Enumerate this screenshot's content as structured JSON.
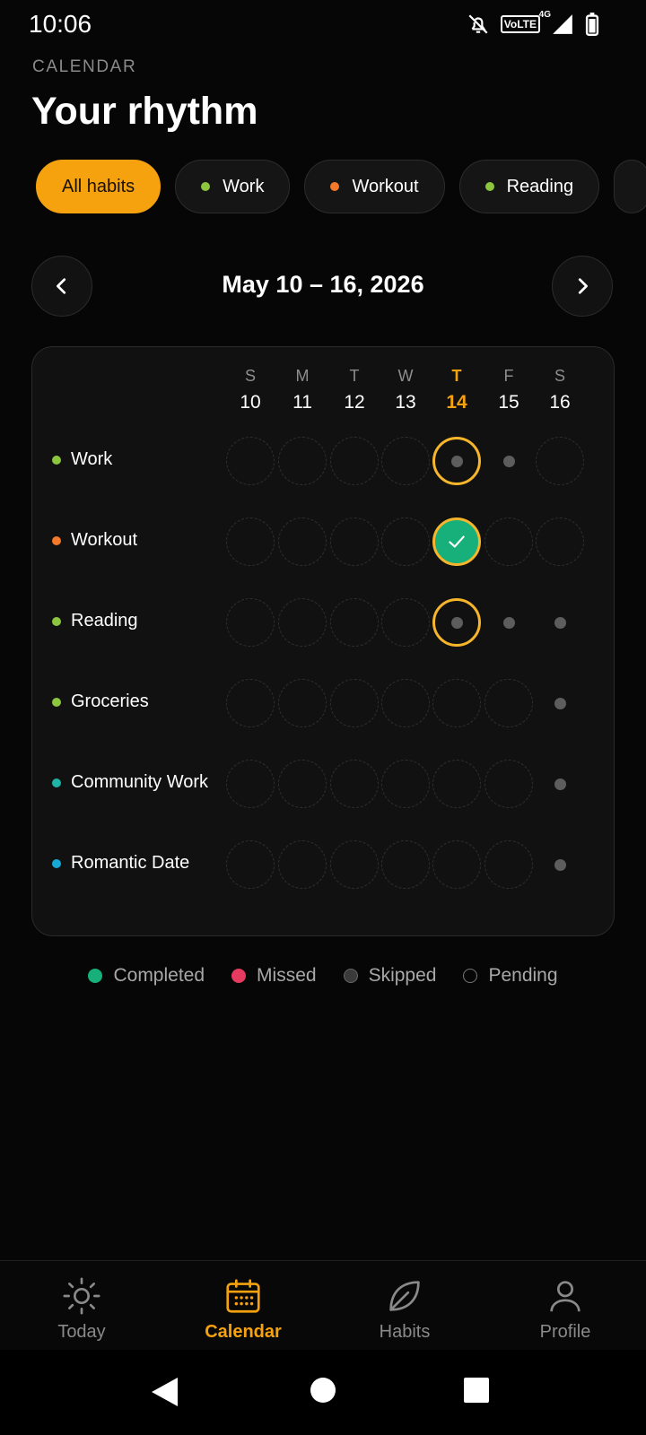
{
  "status_bar": {
    "time": "10:06",
    "network_label": "VoLTE",
    "network_gen": "4G",
    "icons": [
      "bell-off-icon",
      "signal-icon",
      "battery-icon"
    ]
  },
  "header": {
    "eyebrow": "CALENDAR",
    "title": "Your rhythm"
  },
  "filters": [
    {
      "label": "All habits",
      "active": true,
      "color": "#f6a20e"
    },
    {
      "label": "Work",
      "active": false,
      "color": "#8cc63f"
    },
    {
      "label": "Workout",
      "active": false,
      "color": "#f5792a"
    },
    {
      "label": "Reading",
      "active": false,
      "color": "#8cc63f"
    }
  ],
  "week": {
    "range": "May 10 – 16, 2026",
    "prev_icon": "chevron-left-icon",
    "next_icon": "chevron-right-icon",
    "days": [
      {
        "letter": "S",
        "num": "10"
      },
      {
        "letter": "M",
        "num": "11"
      },
      {
        "letter": "T",
        "num": "12"
      },
      {
        "letter": "W",
        "num": "13"
      },
      {
        "letter": "T",
        "num": "14",
        "today": true
      },
      {
        "letter": "F",
        "num": "15"
      },
      {
        "letter": "S",
        "num": "16"
      }
    ]
  },
  "habits": [
    {
      "name": "Work",
      "color": "#8cc63f",
      "states": [
        "pending",
        "pending",
        "pending",
        "pending",
        "today-skipped",
        "skipped",
        "pending"
      ]
    },
    {
      "name": "Workout",
      "color": "#f5792a",
      "states": [
        "pending",
        "pending",
        "pending",
        "pending",
        "completed",
        "pending",
        "pending"
      ]
    },
    {
      "name": "Reading",
      "color": "#8cc63f",
      "states": [
        "pending",
        "pending",
        "pending",
        "pending",
        "today-skipped",
        "skipped",
        "skipped"
      ]
    },
    {
      "name": "Groceries",
      "color": "#8cc63f",
      "states": [
        "pending",
        "pending",
        "pending",
        "pending",
        "pending",
        "pending",
        "skipped"
      ]
    },
    {
      "name": "Community Work",
      "color": "#1fb5a6",
      "states": [
        "pending",
        "pending",
        "pending",
        "pending",
        "pending",
        "pending",
        "skipped"
      ]
    },
    {
      "name": "Romantic Date",
      "color": "#17a9d6",
      "states": [
        "pending",
        "pending",
        "pending",
        "pending",
        "pending",
        "pending",
        "skipped"
      ]
    }
  ],
  "legend": [
    {
      "label": "Completed",
      "color": "#17b07a"
    },
    {
      "label": "Missed",
      "color": "#e63b5e"
    },
    {
      "label": "Skipped",
      "color": "#3a3a3a"
    },
    {
      "label": "Pending",
      "color": "transparent"
    }
  ],
  "bottom_nav": [
    {
      "label": "Today",
      "icon": "sun-icon"
    },
    {
      "label": "Calendar",
      "icon": "calendar-icon",
      "active": true
    },
    {
      "label": "Habits",
      "icon": "leaf-icon"
    },
    {
      "label": "Profile",
      "icon": "person-icon"
    }
  ],
  "system_nav": [
    "back-icon",
    "home-icon",
    "recents-icon"
  ]
}
